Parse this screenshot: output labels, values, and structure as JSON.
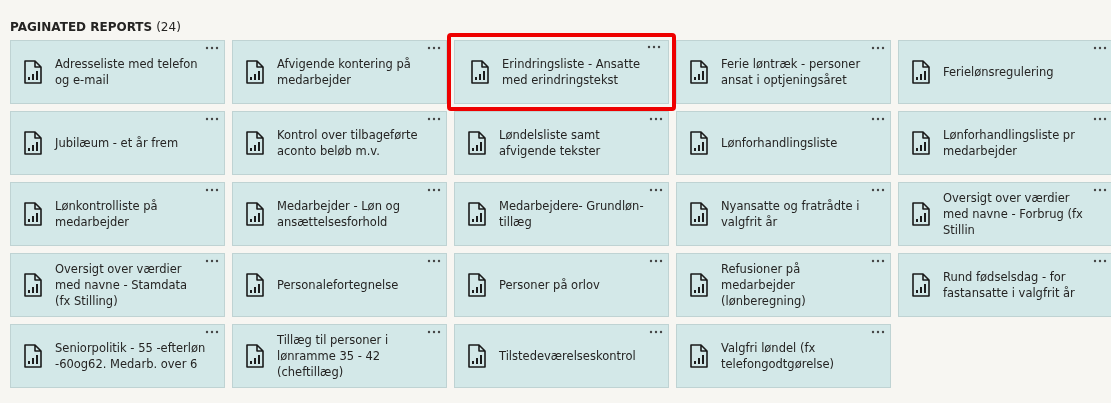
{
  "section": {
    "title": "PAGINATED REPORTS",
    "count": "(24)"
  },
  "reports": [
    {
      "title": "Adresseliste med telefon og e-mail",
      "highlighted": false
    },
    {
      "title": "Afvigende kontering på medarbejder",
      "highlighted": false
    },
    {
      "title": "Erindringsliste - Ansatte med erindringstekst",
      "highlighted": true
    },
    {
      "title": "Ferie løntræk - personer ansat i optjeningsåret",
      "highlighted": false
    },
    {
      "title": "Ferielønsregulering",
      "highlighted": false
    },
    {
      "title": "Jubilæum - et år frem",
      "highlighted": false
    },
    {
      "title": "Kontrol over tilbageførte aconto beløb m.v.",
      "highlighted": false
    },
    {
      "title": "Løndelsliste samt afvigende tekster",
      "highlighted": false
    },
    {
      "title": "Lønforhandlingsliste",
      "highlighted": false
    },
    {
      "title": "Lønforhandlingsliste pr medarbejder",
      "highlighted": false
    },
    {
      "title": "Lønkontrolliste på medarbejder",
      "highlighted": false
    },
    {
      "title": "Medarbejder - Løn og ansættelsesforhold",
      "highlighted": false
    },
    {
      "title": "Medarbejdere- Grundløn-tillæg",
      "highlighted": false
    },
    {
      "title": "Nyansatte og fratrådte i valgfrit år",
      "highlighted": false
    },
    {
      "title": "Oversigt over værdier med navne - Forbrug (fx Stillin",
      "highlighted": false
    },
    {
      "title": "Oversigt over værdier med navne - Stamdata (fx Stilling)",
      "highlighted": false
    },
    {
      "title": "Personalefortegnelse",
      "highlighted": false
    },
    {
      "title": "Personer på orlov",
      "highlighted": false
    },
    {
      "title": "Refusioner på medarbejder (lønberegning)",
      "highlighted": false
    },
    {
      "title": "Rund fødselsdag - for fastansatte i valgfrit år",
      "highlighted": false
    },
    {
      "title": "Seniorpolitik - 55 -efterløn -60og62. Medarb. over 6",
      "highlighted": false
    },
    {
      "title": "Tillæg til personer i lønramme 35 - 42 (cheftillæg)",
      "highlighted": false
    },
    {
      "title": "Tilstedeværelseskontrol",
      "highlighted": false
    },
    {
      "title": "Valgfri løndel (fx telefongodtgørelse)",
      "highlighted": false
    }
  ]
}
